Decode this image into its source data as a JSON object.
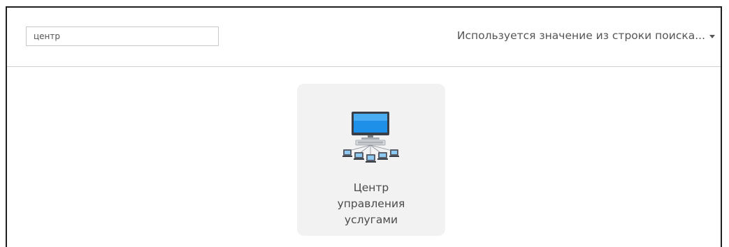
{
  "search": {
    "value": "центр"
  },
  "source_menu": {
    "label": "Используется значение из строки поиска...",
    "icon": "caret-down-icon"
  },
  "results": [
    {
      "label_lines": [
        "Центр",
        "управления",
        "услугами"
      ],
      "icon": "service-management-center-icon"
    }
  ]
}
